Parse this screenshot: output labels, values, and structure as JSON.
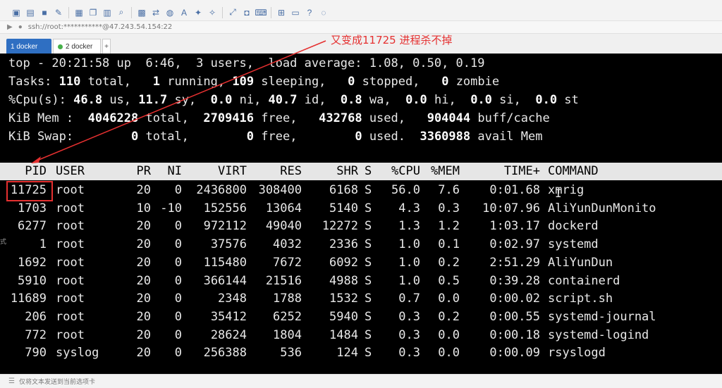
{
  "toolbar": {
    "icons": [
      "new-session-icon",
      "open-folder-icon",
      "save-icon",
      "edit-icon",
      "properties-icon",
      "copy-icon",
      "paste-icon",
      "find-icon",
      "print-icon",
      "transfer-icon",
      "globe-icon",
      "font-icon",
      "script-icon",
      "xftp-icon",
      "fullscreen-icon",
      "lock-icon",
      "keyboard-icon",
      "compose-icon",
      "layout-icon",
      "help-icon",
      "chat-icon"
    ]
  },
  "address": {
    "url": "ssh://root:***********@47.243.54.154:22"
  },
  "tabs": [
    {
      "label": "1 docker",
      "active": true
    },
    {
      "label": "2 docker",
      "active": false
    }
  ],
  "annotation": {
    "text": "又变成11725  进程杀不掉",
    "color": "#e53030"
  },
  "top": {
    "line1": "top - 20:21:58 up  6:46,  3 users,  load average: 1.08, 0.50, 0.19",
    "tasks": {
      "prefix": "Tasks: ",
      "total": "110",
      "total_label": " total,   ",
      "running": "1",
      "running_label": " running, ",
      "sleeping": "109",
      "sleeping_label": " sleeping,   ",
      "stopped": "0",
      "stopped_label": " stopped,   ",
      "zombie": "0",
      "zombie_label": " zombie"
    },
    "cpu": {
      "prefix": "%Cpu(s): ",
      "us": "46.8",
      "us_label": " us, ",
      "sy": "11.7",
      "sy_label": " sy,  ",
      "ni": "0.0",
      "ni_label": " ni, ",
      "id": "40.7",
      "id_label": " id,  ",
      "wa": "0.8",
      "wa_label": " wa,  ",
      "hi": "0.0",
      "hi_label": " hi,  ",
      "si": "0.0",
      "si_label": " si,  ",
      "st": "0.0",
      "st_label": " st"
    },
    "mem": {
      "prefix": "KiB Mem :  ",
      "total": "4046228",
      "total_label": " total,  ",
      "free": "2709416",
      "free_label": " free,   ",
      "used": "432768",
      "used_label": " used,   ",
      "cache": "904044",
      "cache_label": " buff/cache"
    },
    "swap": {
      "prefix": "KiB Swap:        ",
      "total": "0",
      "total_label": " total,        ",
      "free": "0",
      "free_label": " free,        ",
      "used": "0",
      "used_label": " used.  ",
      "avail": "3360988",
      "avail_label": " avail Mem"
    }
  },
  "table": {
    "headers": [
      "PID",
      "USER",
      "PR",
      "NI",
      "VIRT",
      "RES",
      "SHR",
      "S",
      "%CPU",
      "%MEM",
      "TIME+",
      "COMMAND"
    ],
    "rows": [
      [
        "11725",
        "root",
        "20",
        "0",
        "2436800",
        "308400",
        "6168",
        "S",
        "56.0",
        "7.6",
        "0:01.68",
        "xmrig"
      ],
      [
        "1703",
        "root",
        "10",
        "-10",
        "152556",
        "13064",
        "5140",
        "S",
        "4.3",
        "0.3",
        "10:07.96",
        "AliYunDunMonito"
      ],
      [
        "6277",
        "root",
        "20",
        "0",
        "972112",
        "49040",
        "12272",
        "S",
        "1.3",
        "1.2",
        "1:03.17",
        "dockerd"
      ],
      [
        "1",
        "root",
        "20",
        "0",
        "37576",
        "4032",
        "2336",
        "S",
        "1.0",
        "0.1",
        "0:02.97",
        "systemd"
      ],
      [
        "1692",
        "root",
        "20",
        "0",
        "115480",
        "7672",
        "6092",
        "S",
        "1.0",
        "0.2",
        "2:51.29",
        "AliYunDun"
      ],
      [
        "5910",
        "root",
        "20",
        "0",
        "366144",
        "21516",
        "4988",
        "S",
        "1.0",
        "0.5",
        "0:39.28",
        "containerd"
      ],
      [
        "11689",
        "root",
        "20",
        "0",
        "2348",
        "1788",
        "1532",
        "S",
        "0.7",
        "0.0",
        "0:00.02",
        "script.sh"
      ],
      [
        "206",
        "root",
        "20",
        "0",
        "35412",
        "6252",
        "5940",
        "S",
        "0.3",
        "0.2",
        "0:00.55",
        "systemd-journal"
      ],
      [
        "772",
        "root",
        "20",
        "0",
        "28624",
        "1804",
        "1484",
        "S",
        "0.3",
        "0.0",
        "0:00.18",
        "systemd-logind"
      ],
      [
        "790",
        "syslog",
        "20",
        "0",
        "256388",
        "536",
        "124",
        "S",
        "0.3",
        "0.0",
        "0:00.09",
        "rsyslogd"
      ]
    ]
  },
  "status": {
    "text": "仅将文本发送到当前选项卡"
  }
}
